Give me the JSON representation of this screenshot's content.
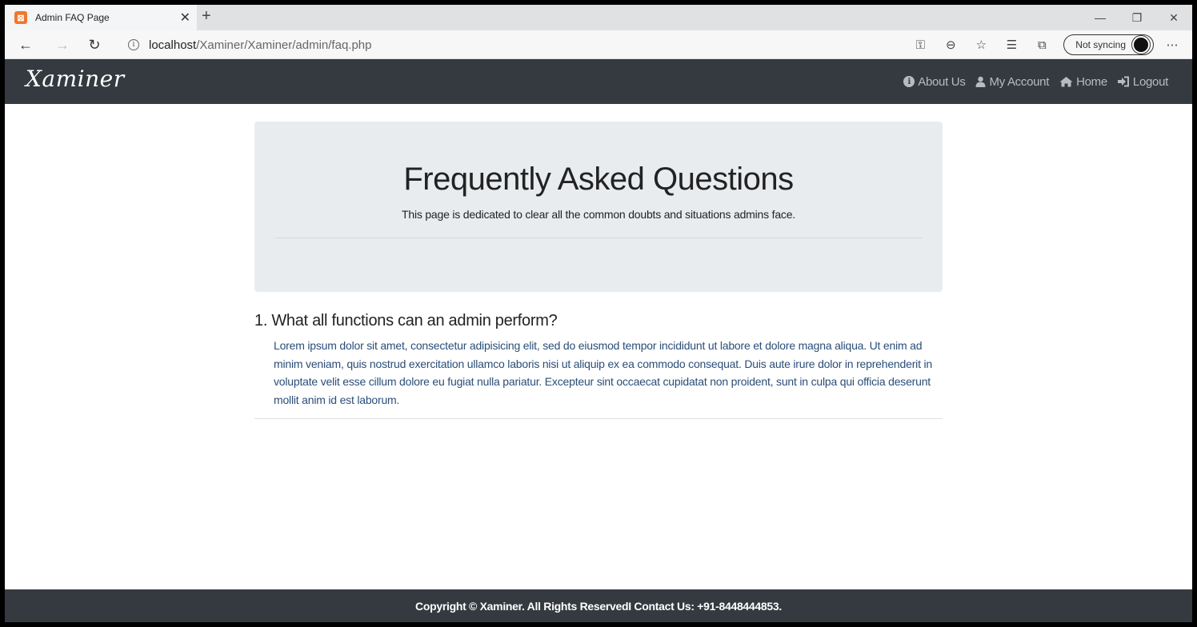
{
  "browser": {
    "tab_title": "Admin FAQ Page",
    "url_host": "localhost",
    "url_path": "/Xaminer/Xaminer/admin/faq.php",
    "sync_label": "Not syncing"
  },
  "navbar": {
    "brand": "Xaminer",
    "links": [
      {
        "label": "About Us",
        "icon": "info-circle-icon"
      },
      {
        "label": "My Account",
        "icon": "user-icon"
      },
      {
        "label": "Home",
        "icon": "home-icon"
      },
      {
        "label": "Logout",
        "icon": "sign-out-icon"
      }
    ]
  },
  "jumbotron": {
    "title": "Frequently Asked Questions",
    "subtitle": "This page is dedicated to clear all the common doubts and situations admins face."
  },
  "faq": [
    {
      "question": "1. What all functions can an admin perform?",
      "answer": "Lorem ipsum dolor sit amet, consectetur adipisicing elit, sed do eiusmod tempor incididunt ut labore et dolore magna aliqua. Ut enim ad minim veniam, quis nostrud exercitation ullamco laboris nisi ut aliquip ex ea commodo consequat. Duis aute irure dolor in reprehenderit in voluptate velit esse cillum dolore eu fugiat nulla pariatur. Excepteur sint occaecat cupidatat non proident, sunt in culpa qui officia deserunt mollit anim id est laborum."
    }
  ],
  "footer": {
    "text": "Copyright © Xaminer. All Rights ReservedI Contact Us: +91-8448444853."
  },
  "colors": {
    "navbar_bg": "#343a40",
    "jumbotron_bg": "#e9ecef",
    "answer_text": "#2a4e78"
  }
}
